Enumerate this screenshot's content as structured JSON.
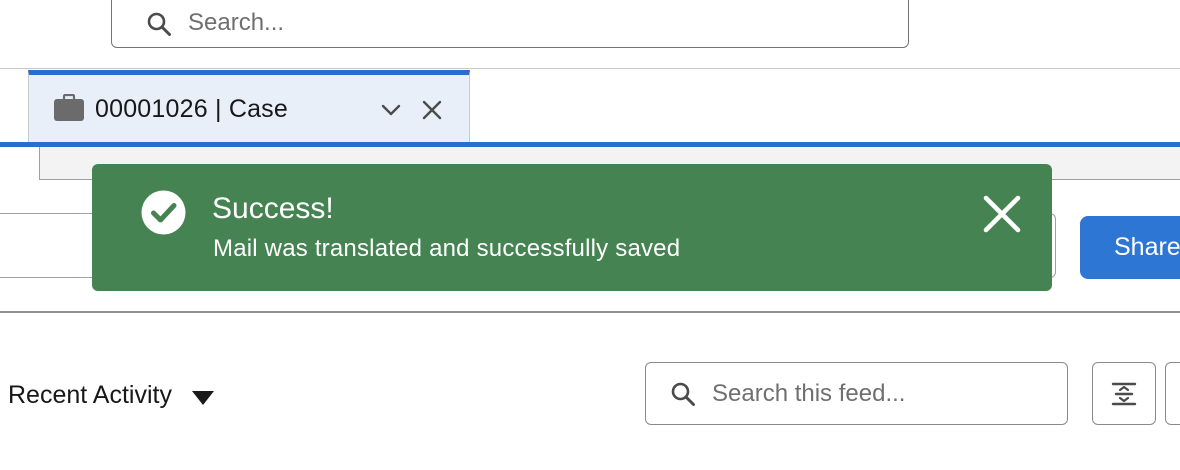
{
  "global_search": {
    "placeholder": "Search..."
  },
  "tab": {
    "label": "00001026 | Case",
    "icon": "briefcase-icon"
  },
  "toast": {
    "title": "Success!",
    "message": "Mail was translated and successfully saved",
    "icon": "check-circle-icon",
    "color": "#458452"
  },
  "header_actions": {
    "share_label": "Share"
  },
  "feed": {
    "filter_label": "Recent Activity",
    "search_placeholder": "Search this feed..."
  },
  "colors": {
    "accent": "#2e6bd1",
    "share_button": "#2e76d3",
    "tab_background": "#e8eff9"
  }
}
